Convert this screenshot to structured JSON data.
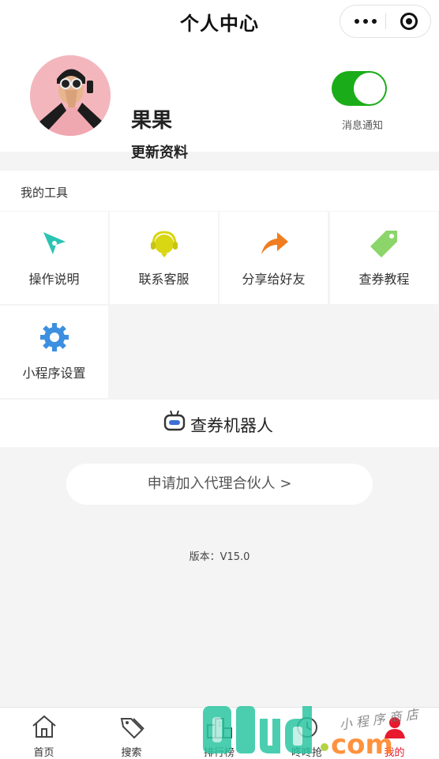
{
  "nav": {
    "title": "个人中心"
  },
  "profile": {
    "username": "果果",
    "update_label": "更新资料",
    "notify_label": "消息通知",
    "notify_on": true,
    "toggle_color": "#1aad19"
  },
  "tools": {
    "header": "我的工具",
    "items": [
      {
        "label": "操作说明",
        "icon": "compass-icon",
        "color": "#2bc4b2"
      },
      {
        "label": "联系客服",
        "icon": "headset-icon",
        "color": "#d9d612"
      },
      {
        "label": "分享给好友",
        "icon": "share-arrow-icon",
        "color": "#f07d20"
      },
      {
        "label": "查券教程",
        "icon": "tag-icon",
        "color": "#8bd56a"
      },
      {
        "label": "小程序设置",
        "icon": "gear-icon",
        "color": "#3d8fe0"
      }
    ]
  },
  "robot": {
    "label": "查券机器人",
    "icon": "robot-icon"
  },
  "apply": {
    "label": "申请加入代理合伙人 >"
  },
  "version": {
    "label": "版本：V15.0"
  },
  "tabbar": {
    "items": [
      {
        "label": "首页",
        "icon": "home-icon"
      },
      {
        "label": "搜索",
        "icon": "tags-icon"
      },
      {
        "label": "排行榜",
        "icon": "podium-icon"
      },
      {
        "label": "咚咚抢",
        "icon": "clock-icon"
      },
      {
        "label": "我的",
        "icon": "user-icon",
        "active": true
      }
    ],
    "active_color": "#e6192e"
  },
  "watermark": {
    "brand": "01ud.com",
    "tagline": "小程序商店"
  }
}
